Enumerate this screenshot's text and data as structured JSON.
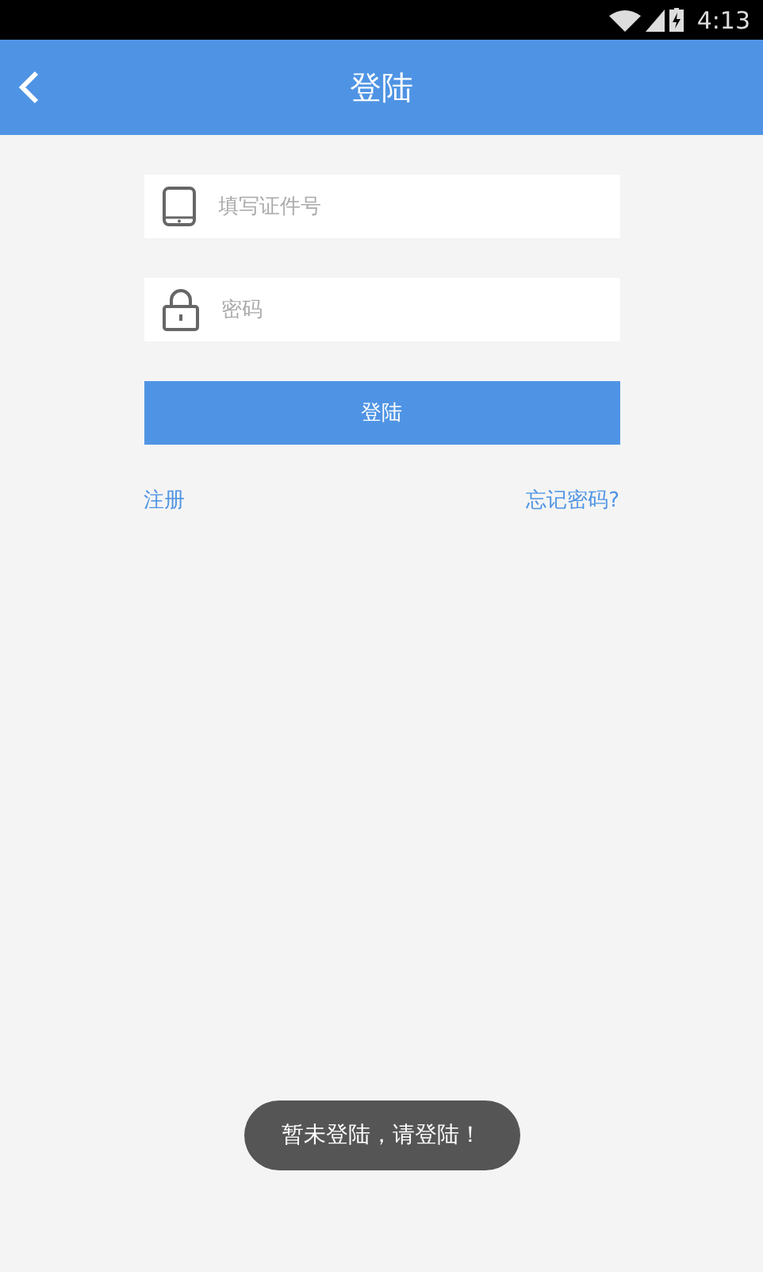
{
  "status_bar": {
    "time": "4:13"
  },
  "header": {
    "title": "登陆"
  },
  "form": {
    "id_field": {
      "placeholder": "填写证件号"
    },
    "password_field": {
      "placeholder": "密码"
    },
    "login_button": "登陆"
  },
  "links": {
    "register": "注册",
    "forgot_password": "忘记密码?"
  },
  "toast": "暂未登陆，请登陆！"
}
